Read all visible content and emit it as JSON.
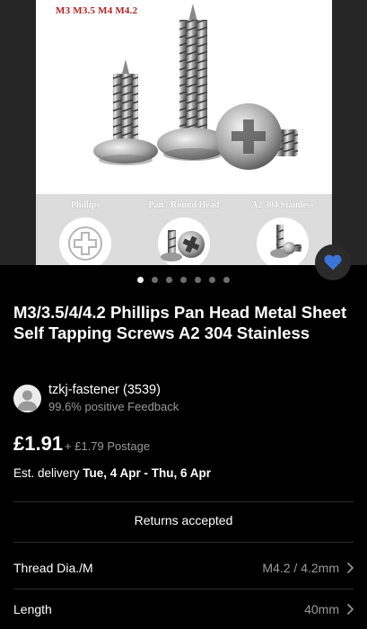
{
  "gallery": {
    "size_caption": "M3 M3.5 M4 M4.2",
    "features": [
      {
        "label": "Phillips",
        "icon": "phillips-head-icon"
      },
      {
        "label": "Pan / Round Head",
        "icon": "pan-head-icon"
      },
      {
        "label": "A2 304 Stainless",
        "icon": "stainless-screw-icon"
      }
    ],
    "page_count": 7,
    "active_page": 1,
    "favorite": true
  },
  "listing": {
    "title": "M3/3.5/4/4.2 Phillips Pan Head Metal Sheet Self Tapping Screws A2 304 Stainless",
    "seller": {
      "name": "tzkj-fastener (3539)",
      "feedback": "99.6% positive Feedback"
    },
    "price": "£1.91",
    "postage": "+ £1.79 Postage",
    "delivery_prefix": "Est. delivery",
    "delivery_dates": "Tue, 4 Apr - Thu, 6 Apr",
    "returns": "Returns accepted"
  },
  "specifics": [
    {
      "label": "Thread Dia./M",
      "value": "M4.2 / 4.2mm"
    },
    {
      "label": "Length",
      "value": "40mm"
    }
  ],
  "colors": {
    "background": "#000000",
    "favorite_heart": "#3b74d9",
    "muted_text": "#9a9a9a",
    "caption_red": "#b32020"
  }
}
